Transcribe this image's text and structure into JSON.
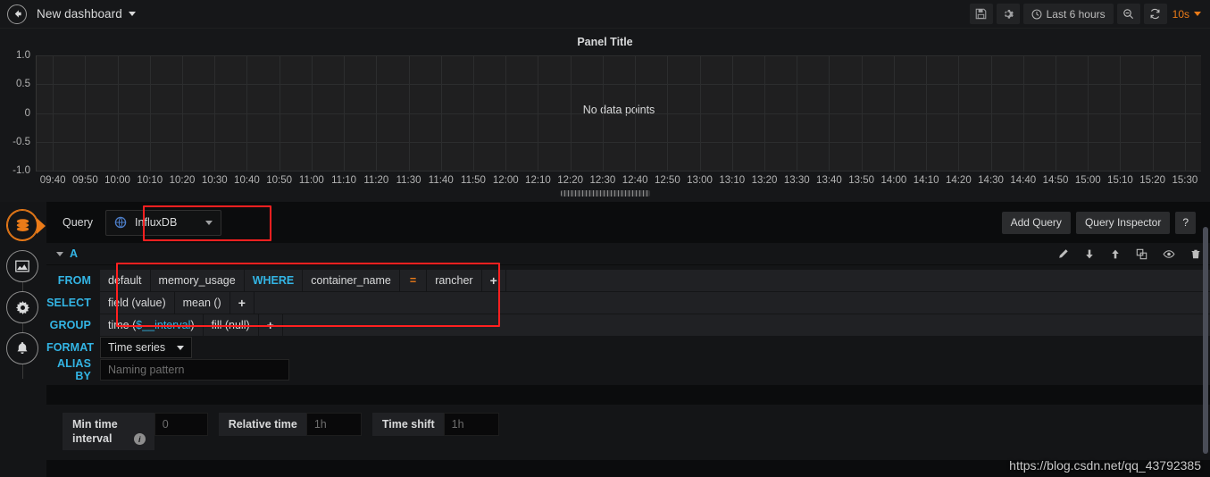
{
  "navbar": {
    "back_icon": "arrow-left-circle-icon",
    "dashboard_title": "New dashboard",
    "save_icon": "save-disk-icon",
    "settings_icon": "gear-icon",
    "time_range": "Last 6 hours",
    "time_icon": "clock-icon",
    "zoom_out_icon": "search-minus-icon",
    "refresh_icon": "refresh-icon",
    "refresh_interval": "10s"
  },
  "panel": {
    "title": "Panel Title",
    "no_data_text": "No data points",
    "drag_handle": "panel-resize-handle"
  },
  "chart_data": {
    "type": "line",
    "title": "Panel Title",
    "series": [],
    "x": [],
    "values": [],
    "xlabel": "",
    "ylabel": "",
    "ylim": [
      -1.0,
      1.0
    ],
    "y_ticks": [
      "1.0",
      "0.5",
      "0",
      "-0.5",
      "-1.0"
    ],
    "y_tick_values": [
      1.0,
      0.5,
      0,
      -0.5,
      -1.0
    ],
    "x_ticks": [
      "09:40",
      "09:50",
      "10:00",
      "10:10",
      "10:20",
      "10:30",
      "10:40",
      "10:50",
      "11:00",
      "11:10",
      "11:20",
      "11:30",
      "11:40",
      "11:50",
      "12:00",
      "12:10",
      "12:20",
      "12:30",
      "12:40",
      "12:50",
      "13:00",
      "13:10",
      "13:20",
      "13:30",
      "13:40",
      "13:50",
      "14:00",
      "14:10",
      "14:20",
      "14:30",
      "14:40",
      "14:50",
      "15:00",
      "15:10",
      "15:20",
      "15:30"
    ],
    "grid": true,
    "legend": "none",
    "annotation": "No data points"
  },
  "sidebar": {
    "items": [
      {
        "name": "queries-tab",
        "icon": "database-icon",
        "active": true
      },
      {
        "name": "visualization-tab",
        "icon": "chart-icon",
        "active": false
      },
      {
        "name": "general-tab",
        "icon": "gear-cog-icon",
        "active": false
      },
      {
        "name": "alert-tab",
        "icon": "bell-icon",
        "active": false
      }
    ]
  },
  "editor": {
    "query_label": "Query",
    "datasource": "InfluxDB",
    "datasource_icon": "influxdb-icon",
    "add_query_label": "Add Query",
    "query_inspector_label": "Query Inspector",
    "help_label": "?",
    "query_row": {
      "ref_id": "A",
      "collapse_icon": "chevron-down-icon",
      "actions": [
        {
          "name": "edit-query-icon",
          "icon": "pencil-icon"
        },
        {
          "name": "move-query-down-icon",
          "icon": "arrow-down-icon"
        },
        {
          "name": "move-query-up-icon",
          "icon": "arrow-up-icon"
        },
        {
          "name": "duplicate-query-icon",
          "icon": "copy-icon"
        },
        {
          "name": "toggle-query-visibility-icon",
          "icon": "eye-icon"
        },
        {
          "name": "remove-query-icon",
          "icon": "trash-icon"
        }
      ]
    },
    "from": {
      "key": "FROM",
      "policy": "default",
      "measurement": "memory_usage",
      "where_keyword": "WHERE",
      "tag_key": "container_name",
      "operator": "=",
      "tag_value": "rancher",
      "add": "+"
    },
    "select": {
      "key": "SELECT",
      "field": "field (value)",
      "aggregation": "mean ()",
      "add": "+"
    },
    "group": {
      "key": "GROUP",
      "time": "time (",
      "time_var": "$__interval",
      "time_close": ")",
      "fill": "fill (null)",
      "add": "+"
    },
    "format": {
      "key": "FORMAT",
      "value": "Time series"
    },
    "alias": {
      "key": "ALIAS BY",
      "placeholder": "Naming pattern",
      "value": ""
    },
    "options": {
      "min_time_interval_label_line1": "Min time",
      "min_time_interval_label_line2": "interval",
      "min_time_interval_placeholder": "0",
      "min_time_interval_value": "",
      "info_icon": "info-icon",
      "relative_time_label": "Relative time",
      "relative_time_placeholder": "1h",
      "relative_time_value": "",
      "time_shift_label": "Time shift",
      "time_shift_placeholder": "1h",
      "time_shift_value": ""
    }
  },
  "highlights": {
    "datasource_box": "red-highlight-datasource",
    "query_box": "red-highlight-query-builder"
  },
  "watermark": "https://blog.csdn.net/qq_43792385",
  "colors": {
    "accent": "#eb7b18",
    "keyword": "#33b5e5",
    "highlight": "#ff2020",
    "panel_bg": "#1f1f20",
    "page_bg": "#161719"
  }
}
